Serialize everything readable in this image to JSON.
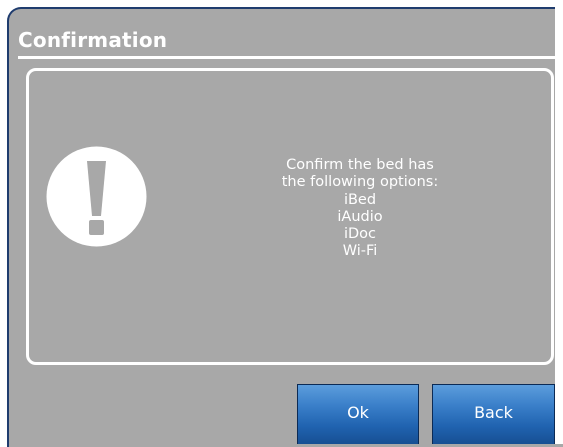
{
  "dialog": {
    "title": "Confirmation",
    "message_lines": [
      "Confirm the bed has",
      "the following options:",
      "iBed",
      "iAudio",
      "iDoc",
      "Wi-Fi"
    ],
    "icon": "exclamation-circle-icon"
  },
  "buttons": {
    "ok_label": "Ok",
    "back_label": "Back"
  },
  "colors": {
    "dialog_background": "#a8a8a8",
    "border": "#1f3c6e",
    "text": "#ffffff",
    "button_top": "#5c9ddc",
    "button_bottom": "#174f93"
  }
}
